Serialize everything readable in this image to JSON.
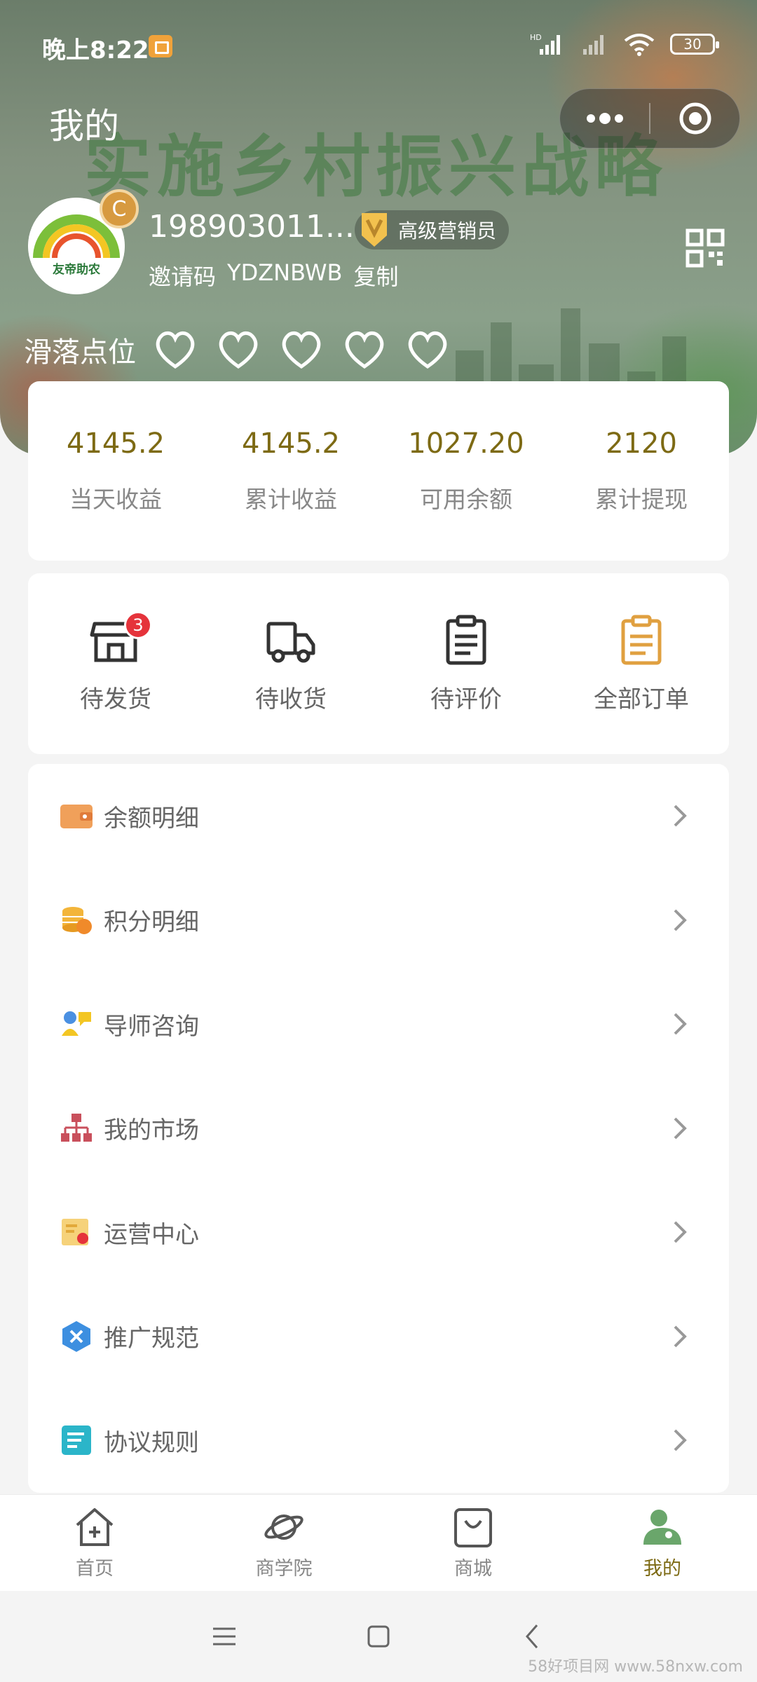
{
  "status_bar": {
    "time": "晚上8:22",
    "signal_label": "HD",
    "battery": "30"
  },
  "header": {
    "title": "我的",
    "banner_slogan": "实施乡村振兴战略"
  },
  "profile": {
    "phone": "198903011...",
    "level": "高级营销员",
    "invite_label": "邀请码",
    "invite_code": "YDZNBWB",
    "copy_label": "复制",
    "avatar_logo_text": "友帝助农"
  },
  "drop_points": {
    "label": "滑落点位",
    "hearts": 5
  },
  "stats": [
    {
      "value": "4145.2",
      "label": "当天收益"
    },
    {
      "value": "4145.2",
      "label": "累计收益"
    },
    {
      "value": "1027.20",
      "label": "可用余额"
    },
    {
      "value": "2120",
      "label": "累计提现"
    }
  ],
  "orders": [
    {
      "label": "待发货",
      "icon": "shop-icon",
      "badge": "3"
    },
    {
      "label": "待收货",
      "icon": "truck-icon"
    },
    {
      "label": "待评价",
      "icon": "clipboard-icon"
    },
    {
      "label": "全部订单",
      "icon": "clipboard-orange-icon"
    }
  ],
  "menu": [
    {
      "label": "余额明细",
      "icon": "wallet-icon"
    },
    {
      "label": "积分明细",
      "icon": "coins-icon"
    },
    {
      "label": "导师咨询",
      "icon": "mentor-icon"
    },
    {
      "label": "我的市场",
      "icon": "org-chart-icon"
    },
    {
      "label": "运营中心",
      "icon": "certificate-icon"
    },
    {
      "label": "推广规范",
      "icon": "hexagon-icon"
    },
    {
      "label": "协议规则",
      "icon": "document-icon"
    }
  ],
  "tabs": [
    {
      "label": "首页",
      "icon": "home-icon",
      "active": false
    },
    {
      "label": "商学院",
      "icon": "planet-icon",
      "active": false
    },
    {
      "label": "商城",
      "icon": "bag-icon",
      "active": false
    },
    {
      "label": "我的",
      "icon": "user-icon",
      "active": true
    }
  ],
  "colors": {
    "accent": "#7d6a14",
    "badge": "#e5333b",
    "active_tab": "#6aa66b"
  },
  "watermark": "58好项目网 www.58nxw.com"
}
